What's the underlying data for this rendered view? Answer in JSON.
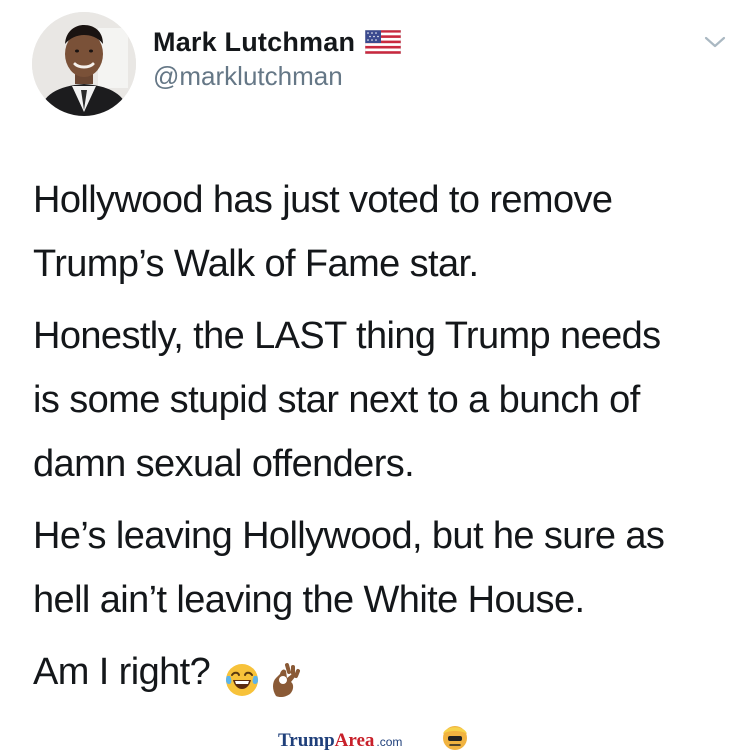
{
  "tweet": {
    "author": {
      "display_name": "Mark Lutchman",
      "handle": "@marklutchman",
      "flag_icon": "us-flag-icon"
    },
    "menu_icon": "chevron-down-icon",
    "paragraphs": [
      {
        "lines": [
          "Hollywood has just voted to remove",
          "Trump’s Walk of Fame star."
        ]
      },
      {
        "lines": [
          "Honestly, the LAST thing Trump needs",
          "is some stupid star next to a bunch of",
          "damn sexual offenders."
        ]
      },
      {
        "lines": [
          "He’s leaving Hollywood, but he sure as",
          "hell ain’t leaving the White House."
        ]
      }
    ],
    "last_line": "Am I right?",
    "emojis": [
      "face-with-tears-of-joy-icon",
      "ok-hand-icon"
    ]
  },
  "watermark": {
    "part1": "Trump",
    "part2": "Area",
    "suffix": ".com",
    "logo_icon": "trump-face-icon"
  },
  "colors": {
    "text": "#14171a",
    "handle": "#657786",
    "watermark_blue": "#1f3f7a",
    "watermark_red": "#c8202a"
  }
}
